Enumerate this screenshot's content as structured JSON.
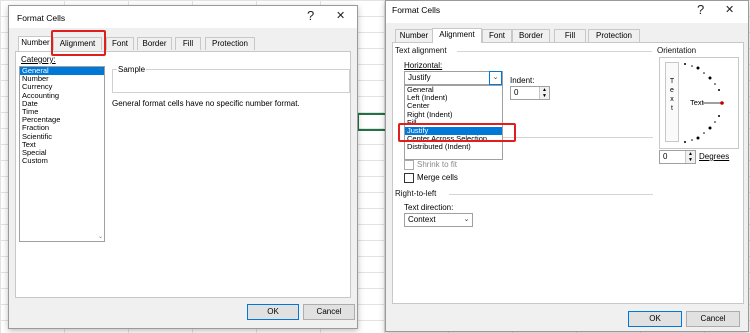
{
  "left": {
    "title": "Format Cells",
    "help": "?",
    "close": "✕",
    "tabs": [
      "Number",
      "Alignment",
      "Font",
      "Border",
      "Fill",
      "Protection"
    ],
    "category_label": "Category:",
    "categories": [
      "General",
      "Number",
      "Currency",
      "Accounting",
      "Date",
      "Time",
      "Percentage",
      "Fraction",
      "Scientific",
      "Text",
      "Special",
      "Custom"
    ],
    "selected_category": "General",
    "sample_label": "Sample",
    "description": "General format cells have no specific number format.",
    "ok": "OK",
    "cancel": "Cancel"
  },
  "right": {
    "title": "Format Cells",
    "help": "?",
    "close": "✕",
    "tabs": [
      "Number",
      "Alignment",
      "Font",
      "Border",
      "Fill",
      "Protection"
    ],
    "text_alignment": "Text alignment",
    "horizontal_label": "Horizontal:",
    "horizontal_value": "Justify",
    "horizontal_options": [
      "General",
      "Left (Indent)",
      "Center",
      "Right (Indent)",
      "Fill",
      "Justify",
      "Center Across Selection",
      "Distributed (Indent)"
    ],
    "indent_label": "Indent:",
    "indent_value": "0",
    "shrink": "Shrink to fit",
    "merge": "Merge cells",
    "rtl": "Right-to-left",
    "text_direction_label": "Text direction:",
    "text_direction_value": "Context",
    "orientation": "Orientation",
    "vertical_text": [
      "T",
      "e",
      "x",
      "t"
    ],
    "dial_text": "Text",
    "degrees_value": "0",
    "degrees_label": "Degrees",
    "ok": "OK",
    "cancel": "Cancel"
  }
}
